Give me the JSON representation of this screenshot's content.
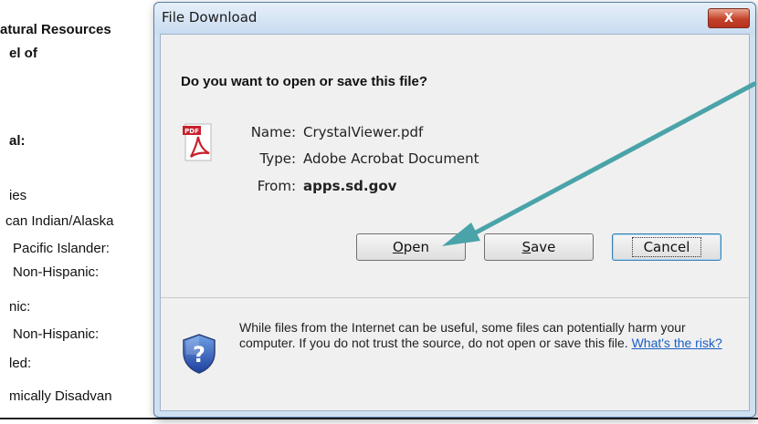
{
  "background_document": {
    "lines": [
      {
        "text": "atural Resources",
        "bold": true
      },
      {
        "text": "el of",
        "bold": true
      },
      {
        "text": "al:",
        "bold": true
      },
      {
        "text": "ies",
        "bold": false
      },
      {
        "text": "can Indian/Alaska",
        "bold": false
      },
      {
        "text": "Pacific Islander:",
        "bold": false
      },
      {
        "text": "Non-Hispanic:",
        "bold": false
      },
      {
        "text": "nic:",
        "bold": false
      },
      {
        "text": "Non-Hispanic:",
        "bold": false
      },
      {
        "text": "led:",
        "bold": false
      },
      {
        "text": "mically Disadvan",
        "bold": false
      }
    ]
  },
  "dialog": {
    "title": "File Download",
    "close_label": "X",
    "question": "Do you want to open or save this file?",
    "file_icon": "pdf-file-icon",
    "file": {
      "name_label": "Name:",
      "name_value": "CrystalViewer.pdf",
      "type_label": "Type:",
      "type_value": "Adobe Acrobat Document",
      "from_label": "From:",
      "from_value": "apps.sd.gov"
    },
    "buttons": {
      "open_mnemonic": "O",
      "open_rest": "pen",
      "save_mnemonic": "S",
      "save_rest": "ave",
      "cancel": "Cancel"
    },
    "warning": {
      "icon": "security-shield-icon",
      "text": "While files from the Internet can be useful, some files can potentially harm your computer. If you do not trust the source, do not open or save this file.",
      "link": "What's the risk?"
    }
  },
  "colors": {
    "arrow": "#4aa3a8",
    "link": "#1a5fc6",
    "close_button": "#c4412a"
  }
}
